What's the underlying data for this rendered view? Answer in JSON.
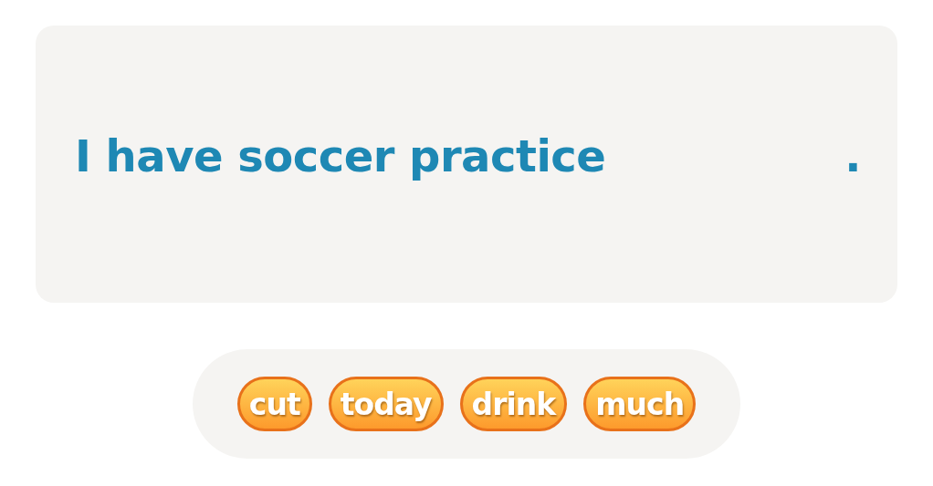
{
  "sentence": {
    "before": "I have soccer practice",
    "after": "."
  },
  "word_bank": [
    {
      "label": "cut"
    },
    {
      "label": "today"
    },
    {
      "label": "drink"
    },
    {
      "label": "much"
    }
  ]
}
